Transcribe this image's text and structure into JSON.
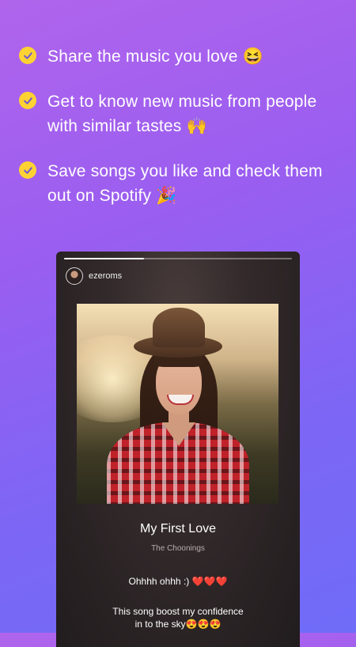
{
  "features": [
    {
      "text": "Share the music you love 😆"
    },
    {
      "text": "Get to know new music from people with similar tastes 🙌"
    },
    {
      "text": "Save songs you like and check them out on Spotify 🎉"
    }
  ],
  "colors": {
    "check": "#ffd233",
    "background_top": "#b064ec",
    "background_bottom": "#6f6cf8"
  },
  "story": {
    "progress": 0.35,
    "username": "ezeroms",
    "song_title": "My First Love",
    "artist": "The Choonings",
    "comment_1": "Ohhhh ohhh :) ❤️❤️❤️",
    "comment_2": "This song boost my confidence\nin to the sky😍😍😍"
  }
}
